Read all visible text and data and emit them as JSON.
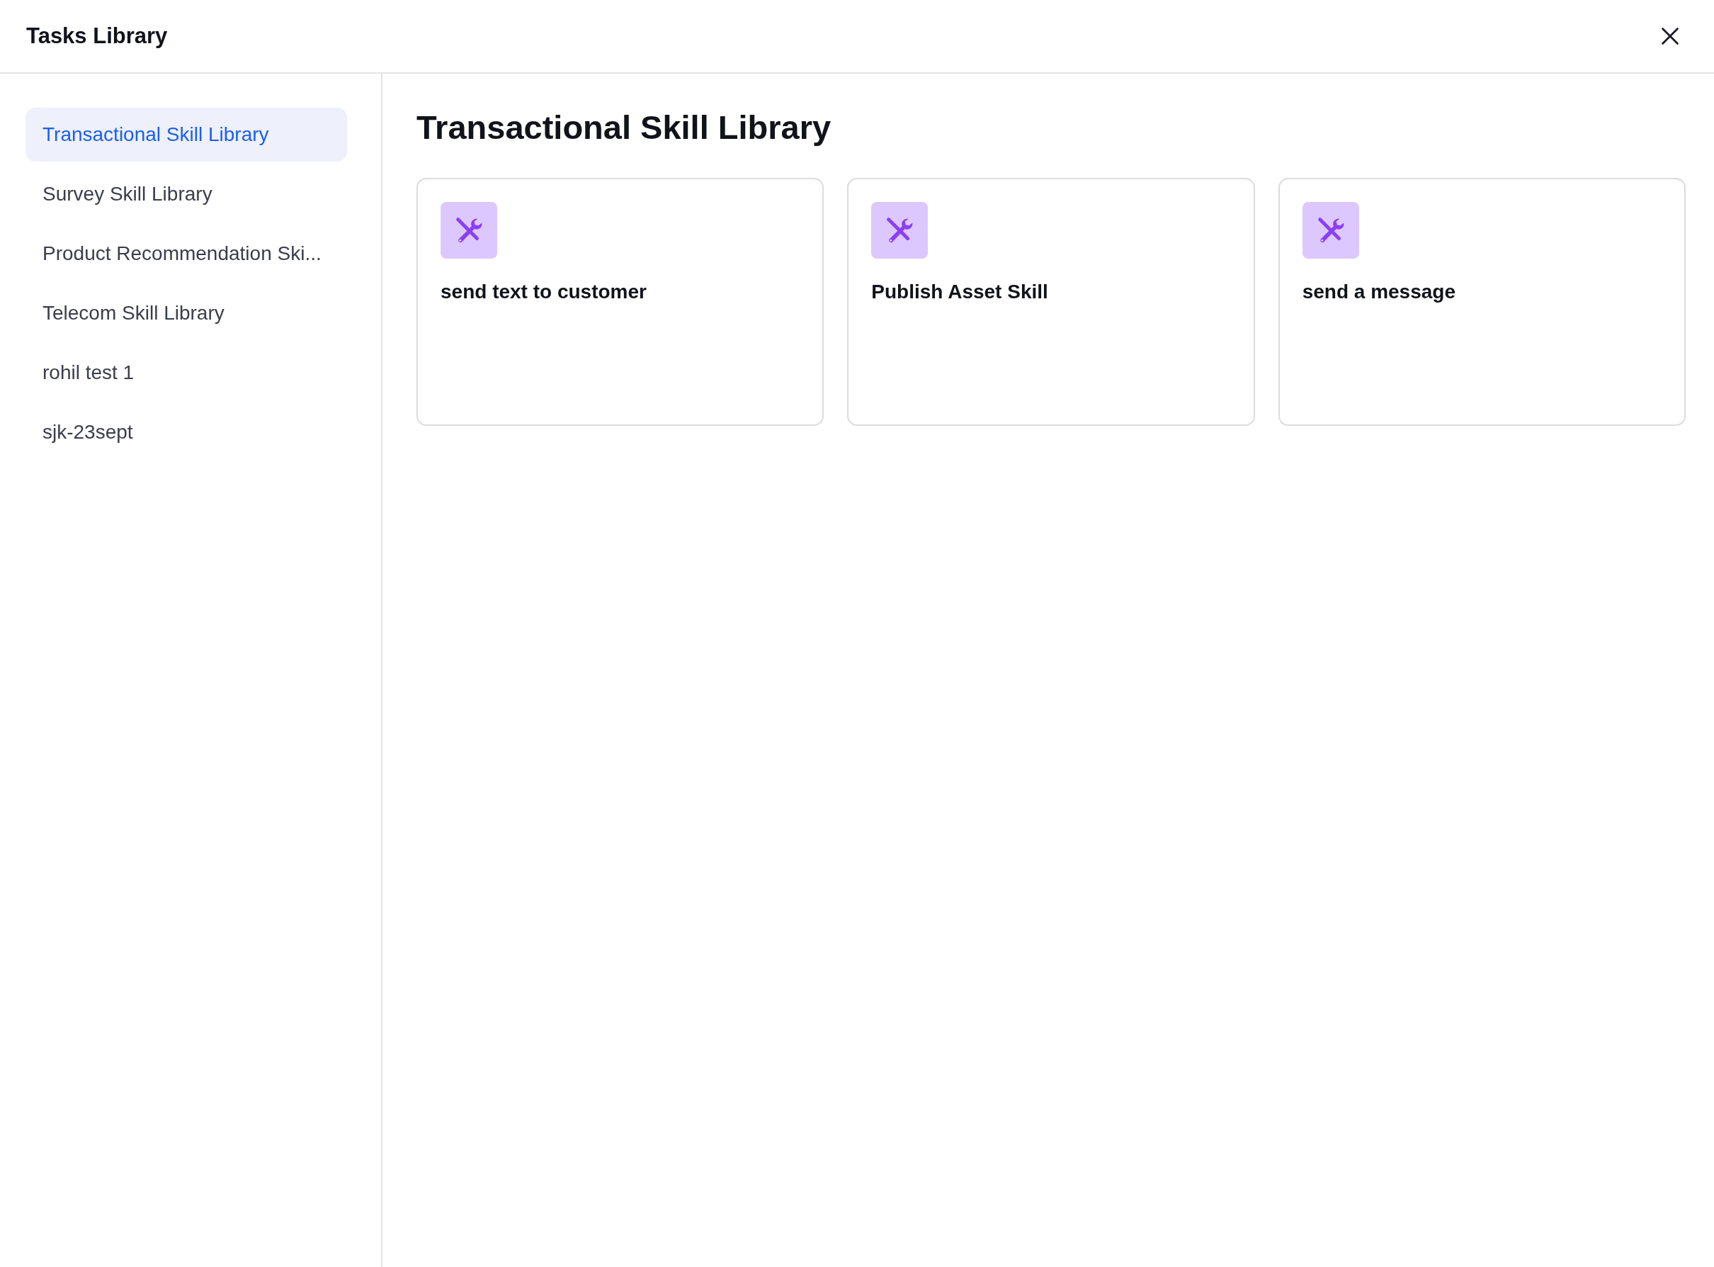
{
  "window": {
    "title": "Tasks Library"
  },
  "sidebar": {
    "items": [
      {
        "label": "Transactional Skill Library",
        "selected": true
      },
      {
        "label": "Survey Skill Library",
        "selected": false
      },
      {
        "label": "Product Recommendation Ski...",
        "selected": false
      },
      {
        "label": "Telecom Skill Library",
        "selected": false
      },
      {
        "label": "rohil test 1",
        "selected": false
      },
      {
        "label": "sjk-23sept",
        "selected": false
      }
    ]
  },
  "main": {
    "heading": "Transactional Skill Library",
    "cards": [
      {
        "title": "send text to customer"
      },
      {
        "title": "Publish Asset Skill"
      },
      {
        "title": "send a message"
      }
    ]
  }
}
